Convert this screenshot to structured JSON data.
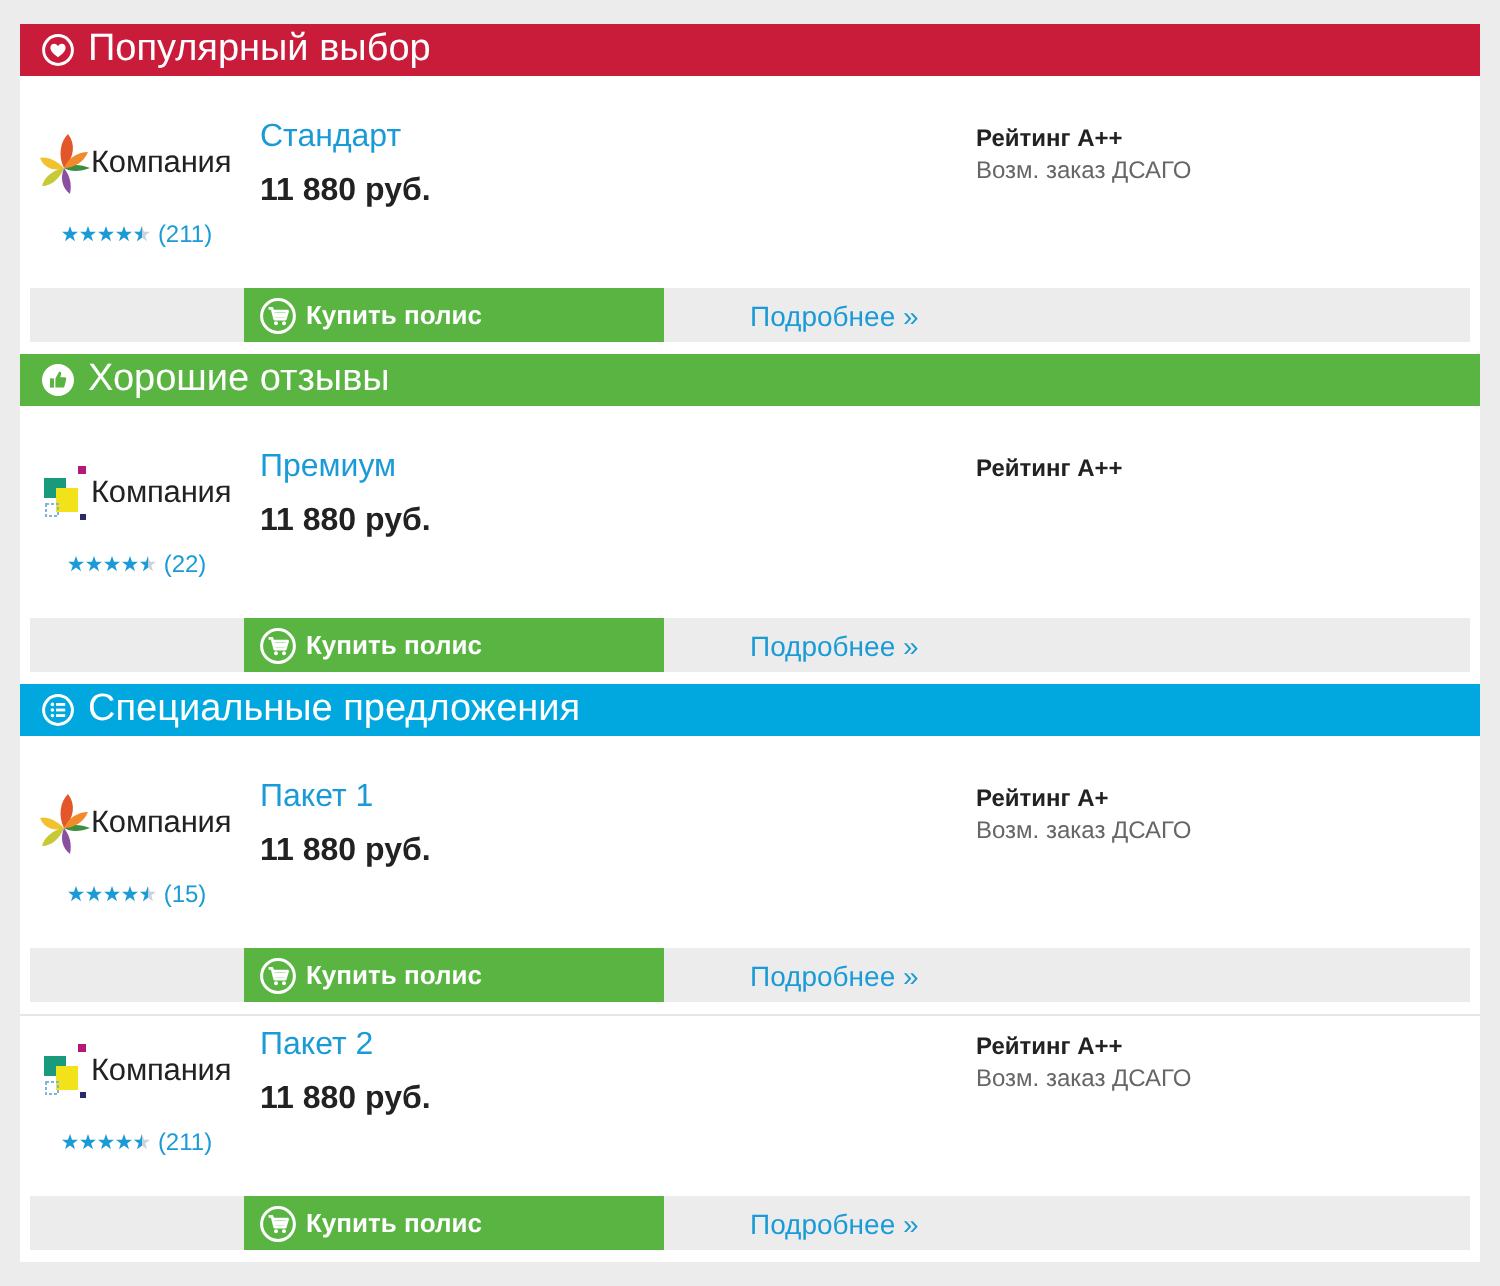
{
  "sections": [
    {
      "kind": "popular",
      "title": "Популярный выбор",
      "color": "#c91b3a",
      "offers": [
        {
          "logo": {
            "kind": "petals",
            "text": "Компания"
          },
          "stars": 4.5,
          "reviews": "(211)",
          "name": "Стандарт",
          "price": "11 880 руб.",
          "rating": "Рейтинг А++",
          "note": "Возм. заказ ДСАГО",
          "buy": "Купить полис",
          "more": "Подробнее »"
        }
      ]
    },
    {
      "kind": "reviews",
      "title": "Хорошие отзывы",
      "color": "#59b441",
      "offers": [
        {
          "logo": {
            "kind": "squares",
            "text": "Компания"
          },
          "stars": 4.5,
          "reviews": "(22)",
          "name": "Премиум",
          "price": "11 880 руб.",
          "rating": "Рейтинг А++",
          "buy": "Купить полис",
          "more": "Подробнее »"
        }
      ]
    },
    {
      "kind": "special",
      "title": "Специальные предложения",
      "color": "#00a8df",
      "offers": [
        {
          "logo": {
            "kind": "petals",
            "text": "Компания"
          },
          "stars": 4.5,
          "reviews": "(15)",
          "name": "Пакет 1",
          "price": "11 880 руб.",
          "rating": "Рейтинг А+",
          "note": "Возм. заказ ДСАГО",
          "buy": "Купить полис",
          "more": "Подробнее »"
        },
        {
          "logo": {
            "kind": "squares",
            "text": "Компания"
          },
          "stars": 4.5,
          "reviews": "(211)",
          "name": "Пакет 2",
          "price": "11 880 руб.",
          "rating": "Рейтинг А++",
          "note": "Возм. заказ ДСАГО",
          "buy": "Купить полис",
          "more": "Подробнее »"
        }
      ]
    }
  ]
}
